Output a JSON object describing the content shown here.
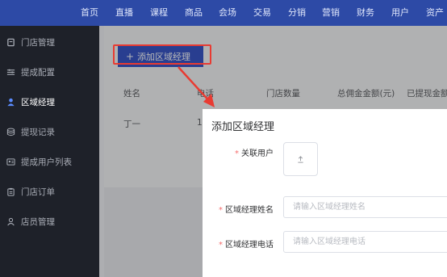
{
  "topnav": {
    "items": [
      "首页",
      "直播",
      "课程",
      "商品",
      "会场",
      "交易",
      "分销",
      "营销",
      "财务",
      "用户",
      "资产"
    ]
  },
  "sidebar": {
    "items": [
      {
        "label": "门店管理",
        "icon": "store-icon"
      },
      {
        "label": "提成配置",
        "icon": "sliders-icon"
      },
      {
        "label": "区域经理",
        "icon": "user-icon",
        "active": true
      },
      {
        "label": "提现记录",
        "icon": "database-icon"
      },
      {
        "label": "提成用户列表",
        "icon": "id-card-icon"
      },
      {
        "label": "门店订单",
        "icon": "clipboard-icon"
      },
      {
        "label": "店员管理",
        "icon": "person-outline-icon"
      }
    ]
  },
  "toolbar": {
    "add_label": "添加区域经理",
    "plus": "+"
  },
  "table": {
    "headers": [
      "姓名",
      "电话",
      "门店数量",
      "总佣金金额(元)",
      "已提现金额"
    ],
    "rows": [
      [
        "丁一",
        "1"
      ]
    ]
  },
  "dialog": {
    "title": "添加区域经理",
    "fields": {
      "user": {
        "label": "关联用户",
        "required": "*"
      },
      "name": {
        "label": "区域经理姓名",
        "required": "*",
        "placeholder": "请输入区域经理姓名"
      },
      "phone": {
        "label": "区域经理电话",
        "required": "*",
        "placeholder": "请输入区域经理电话"
      }
    }
  },
  "colors": {
    "nav_bg": "#2d4aa6",
    "sidebar_bg": "#1e2129",
    "primary": "#3a57c8",
    "highlight": "#e83b32",
    "required": "#f56c6c"
  }
}
